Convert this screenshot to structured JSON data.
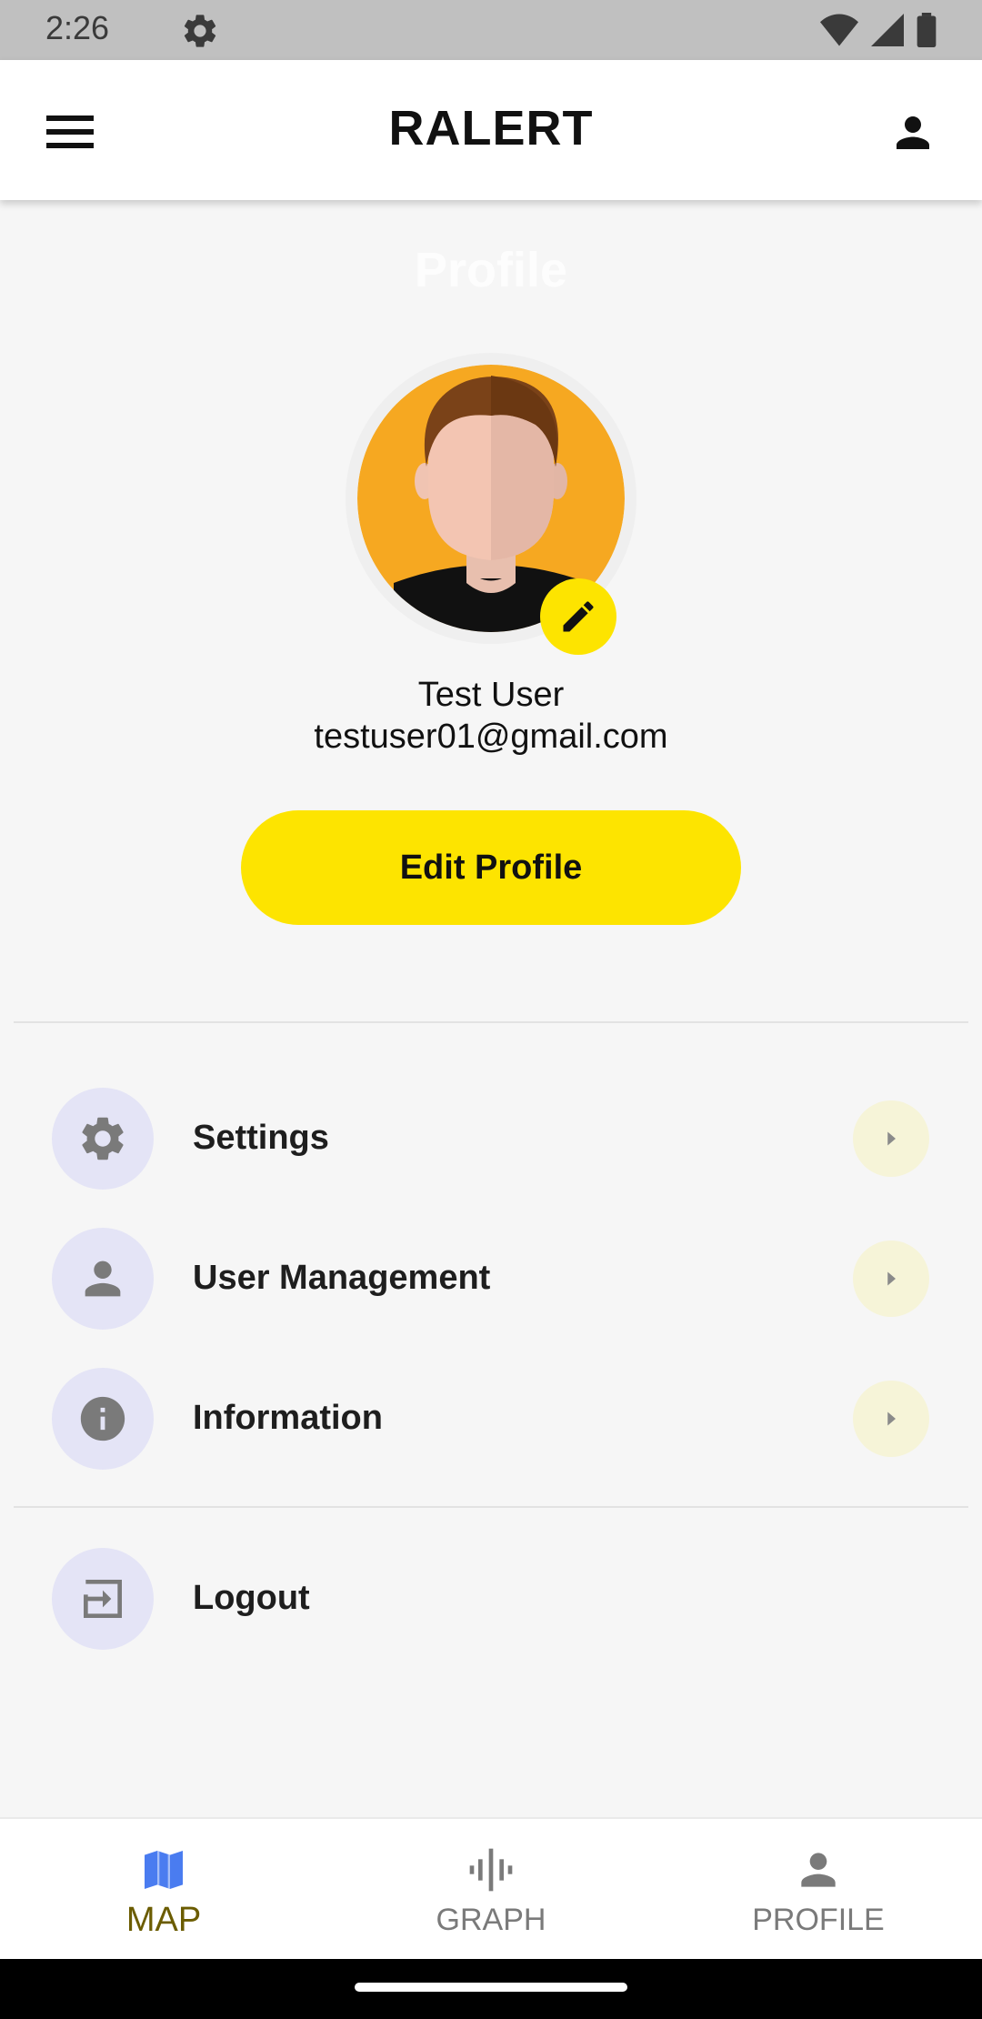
{
  "status_bar": {
    "time": "2:26",
    "icons": [
      "gear-icon",
      "wifi-icon",
      "signal-icon",
      "battery-icon"
    ]
  },
  "app_bar": {
    "title": "RALERT",
    "icons": [
      "menu-icon",
      "account-icon"
    ]
  },
  "page": {
    "heading": "Profile"
  },
  "profile": {
    "name": "Test User",
    "email": "testuser01@gmail.com",
    "edit_button_label": "Edit Profile",
    "avatar_edit_icon": "pencil-icon"
  },
  "menu": {
    "items": [
      {
        "label": "Settings",
        "icon": "gear-icon"
      },
      {
        "label": "User Management",
        "icon": "person-icon"
      },
      {
        "label": "Information",
        "icon": "info-icon"
      }
    ],
    "logout": {
      "label": "Logout",
      "icon": "logout-icon"
    }
  },
  "bottom_nav": {
    "active": "MAP",
    "items": [
      {
        "label": "MAP",
        "icon": "map-icon"
      },
      {
        "label": "GRAPH",
        "icon": "graph-icon"
      },
      {
        "label": "PROFILE",
        "icon": "person-icon"
      }
    ]
  },
  "colors": {
    "accent": "#fde400",
    "active_nav": "#4a7cf0",
    "icon_circle": "#e4e4f6"
  }
}
